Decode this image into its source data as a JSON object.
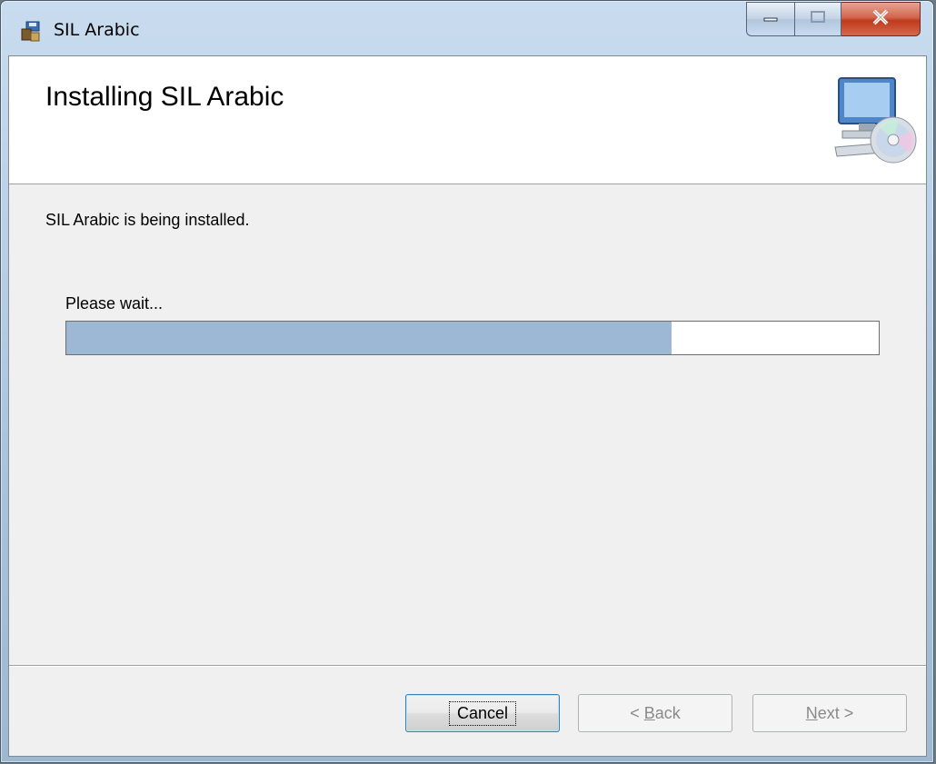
{
  "window": {
    "title": "SIL Arabic",
    "icons": {
      "app": "installer-icon",
      "minimize": "minimize-icon",
      "maximize": "maximize-icon",
      "close": "close-icon"
    }
  },
  "banner": {
    "title": "Installing SIL Arabic",
    "icon": "computer-disc-icon"
  },
  "body": {
    "message": "SIL Arabic is being installed.",
    "wait_label": "Please wait...",
    "progress": 0.745
  },
  "buttons": {
    "cancel": "Cancel",
    "back_prefix": "< ",
    "back_mnemonic": "B",
    "back_rest": "ack",
    "next_mnemonic": "N",
    "next_rest": "ext >"
  },
  "colors": {
    "progress_fill": "#9cb8d4",
    "close_button": "#c94a2b",
    "titlebar": "#aac4de"
  }
}
